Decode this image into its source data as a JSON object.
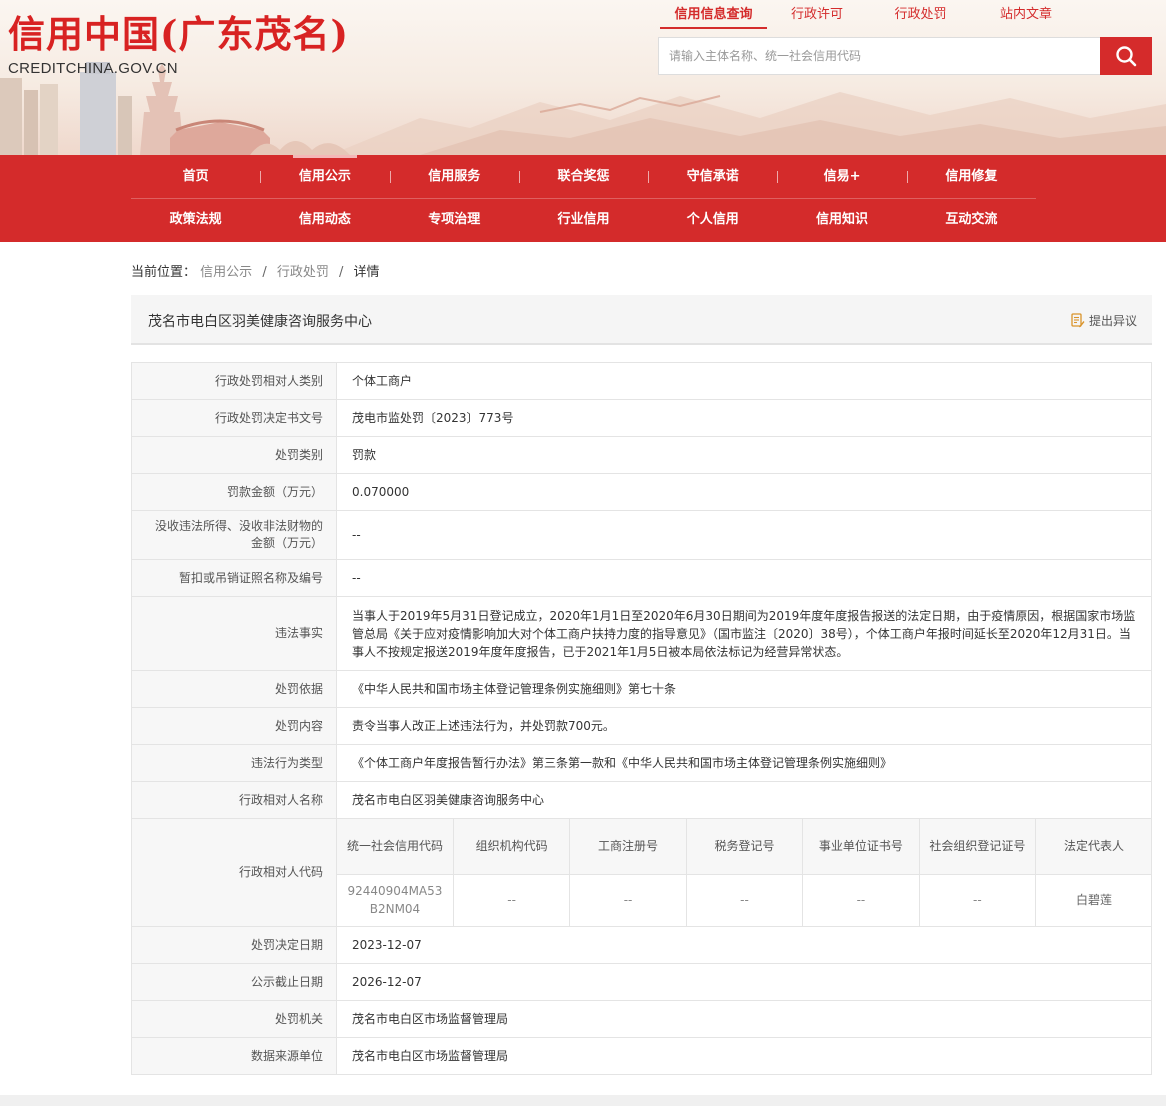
{
  "header": {
    "logo_title": "信用中国(广东茂名)",
    "logo_sub": "CREDITCHINA.GOV.CN",
    "top_links": [
      "信用信息查询",
      "行政许可",
      "行政处罚",
      "站内文章"
    ],
    "search_placeholder": "请输入主体名称、统一社会信用代码"
  },
  "nav": {
    "row1": [
      "首页",
      "信用公示",
      "信用服务",
      "联合奖惩",
      "守信承诺",
      "信易+",
      "信用修复"
    ],
    "row2": [
      "政策法规",
      "信用动态",
      "专项治理",
      "行业信用",
      "个人信用",
      "信用知识",
      "互动交流"
    ],
    "active": "信用公示"
  },
  "breadcrumb": {
    "prefix": "当前位置：",
    "items": [
      "信用公示",
      "行政处罚",
      "详情"
    ],
    "sep": "/"
  },
  "detail": {
    "entity_name": "茂名市电白区羽美健康咨询服务中心",
    "objection_label": "提出异议",
    "rows": [
      {
        "label": "行政处罚相对人类别",
        "value": "个体工商户"
      },
      {
        "label": "行政处罚决定书文号",
        "value": "茂电市监处罚〔2023〕773号"
      },
      {
        "label": "处罚类别",
        "value": "罚款"
      },
      {
        "label": "罚款金额（万元）",
        "value": "0.070000"
      },
      {
        "label": "没收违法所得、没收非法财物的金额（万元）",
        "value": "--"
      },
      {
        "label": "暂扣或吊销证照名称及编号",
        "value": "--"
      },
      {
        "label": "违法事实",
        "value": "当事人于2019年5月31日登记成立，2020年1月1日至2020年6月30日期间为2019年度年度报告报送的法定日期，由于疫情原因，根据国家市场监管总局《关于应对疫情影响加大对个体工商户扶持力度的指导意见》（国市监注〔2020〕38号），个体工商户年报时间延长至2020年12月31日。当事人不按规定报送2019年度年度报告，已于2021年1月5日被本局依法标记为经营异常状态。"
      },
      {
        "label": "处罚依据",
        "value": "《中华人民共和国市场主体登记管理条例实施细则》第七十条"
      },
      {
        "label": "处罚内容",
        "value": "责令当事人改正上述违法行为，并处罚款700元。"
      },
      {
        "label": "违法行为类型",
        "value": "《个体工商户年度报告暂行办法》第三条第一款和《中华人民共和国市场主体登记管理条例实施细则》"
      },
      {
        "label": "行政相对人名称",
        "value": "茂名市电白区羽美健康咨询服务中心"
      }
    ],
    "code_row": {
      "label": "行政相对人代码",
      "headers": [
        "统一社会信用代码",
        "组织机构代码",
        "工商注册号",
        "税务登记号",
        "事业单位证书号",
        "社会组织登记证号",
        "法定代表人"
      ],
      "values": [
        "92440904MA53B2NM04",
        "--",
        "--",
        "--",
        "--",
        "--",
        "白碧莲"
      ]
    },
    "rows_after": [
      {
        "label": "处罚决定日期",
        "value": "2023-12-07"
      },
      {
        "label": "公示截止日期",
        "value": "2026-12-07"
      },
      {
        "label": "处罚机关",
        "value": "茂名市电白区市场监督管理局"
      },
      {
        "label": "数据来源单位",
        "value": "茂名市电白区市场监督管理局"
      }
    ]
  },
  "colors": {
    "brand_red": "#d42b2b",
    "logo_red": "#d82222"
  },
  "icons": [
    "search-icon",
    "objection-icon"
  ]
}
